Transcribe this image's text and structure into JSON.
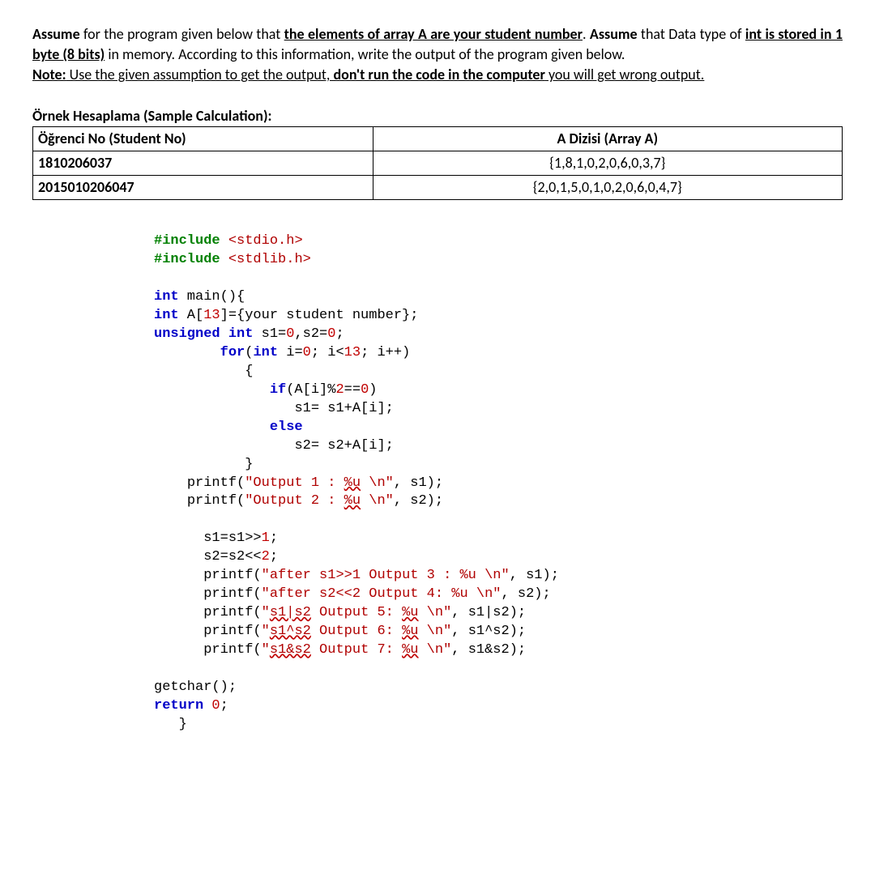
{
  "intro": {
    "line1_a": "Assume",
    "line1_b": " for the program given below that ",
    "line1_c": "the elements of array A are your student number",
    "line1_d": ".",
    "line2_a": "Assume",
    "line2_b": " that Data type of ",
    "line2_c": "int is stored in 1 byte (8 bits)",
    "line2_d": " in memory. According to this information, write the output of the program given below.",
    "line3_a": "Note:",
    "line3_b": " Use the given assumption to get the output, ",
    "line3_c": "don't run the code in the computer",
    "line3_d": " you will get wrong output."
  },
  "sample": {
    "title": "Örnek Hesaplama (Sample Calculation):",
    "h1": "Öğrenci No (Student No)",
    "h2": "A Dizisi (Array A)",
    "r1c1": "1810206037",
    "r1c2": "{1,8,1,0,2,0,6,0,3,7}",
    "r2c1": "2015010206047",
    "r2c2": "{2,0,1,5,0,1,0,2,0,6,0,4,7}"
  },
  "code": {
    "inc1a": "#include ",
    "inc1b": "<stdio.h>",
    "inc2a": "#include ",
    "inc2b": "<stdlib.h>",
    "main1": "int",
    "main2": " main(){",
    "arr1": "int",
    "arr2": " A[",
    "arr3": "13",
    "arr4": "]={your student number};",
    "us1": "unsigned int",
    "us2": " s1=",
    "us3": "0",
    "us4": ",s2=",
    "us5": "0",
    "us6": ";",
    "for1": "for",
    "for2": "(",
    "for3": "int",
    "for4": " i=",
    "for5": "0",
    "for6": "; i<",
    "for7": "13",
    "for8": "; i++)",
    "brace_o": "{",
    "if1": "if",
    "if2": "(A[i]%",
    "if3": "2",
    "if4": "==",
    "if5": "0",
    "if6": ")",
    "s1line": "s1= s1+A[i];",
    "else": "else",
    "s2line": "s2= s2+A[i];",
    "brace_c": "}",
    "p1a": "printf(",
    "p1b": "\"Output 1 : ",
    "p1c": "%u",
    "p1d": " \\n\"",
    "p1e": ", s1);",
    "p2a": "printf(",
    "p2b": "\"Output 2 : ",
    "p2c": "%u",
    "p2d": " \\n\"",
    "p2e": ", s2);",
    "sh1": "s1=s1>>",
    "sh1n": "1",
    "sh1e": ";",
    "sh2": "s2=s2<<",
    "sh2n": "2",
    "sh2e": ";",
    "p3a": "printf(",
    "p3b": "\"after s1>>1 Output 3 : %u \\n\"",
    "p3e": ", s1);",
    "p4a": "printf(",
    "p4b": "\"after s2<<2 Output 4: %u \\n\"",
    "p4e": ", s2);",
    "p5a": "printf(",
    "p5b": "\"",
    "p5w": "s1|s2",
    "p5c": " Output 5: ",
    "p5u": "%u",
    "p5d": " \\n\"",
    "p5e": ", s1|s2);",
    "p6a": "printf(",
    "p6b": "\"",
    "p6w": "s1^s2",
    "p6c": " Output 6: ",
    "p6u": "%u",
    "p6d": " \\n\"",
    "p6e": ", s1^s2);",
    "p7a": "printf(",
    "p7b": "\"",
    "p7w": "s1&s2",
    "p7c": " Output 7: ",
    "p7u": "%u",
    "p7d": " \\n\"",
    "p7e": ", s1&s2);",
    "getch": "getchar();",
    "ret1": "return",
    "ret2": " 0",
    "ret3": ";",
    "end": "}"
  }
}
